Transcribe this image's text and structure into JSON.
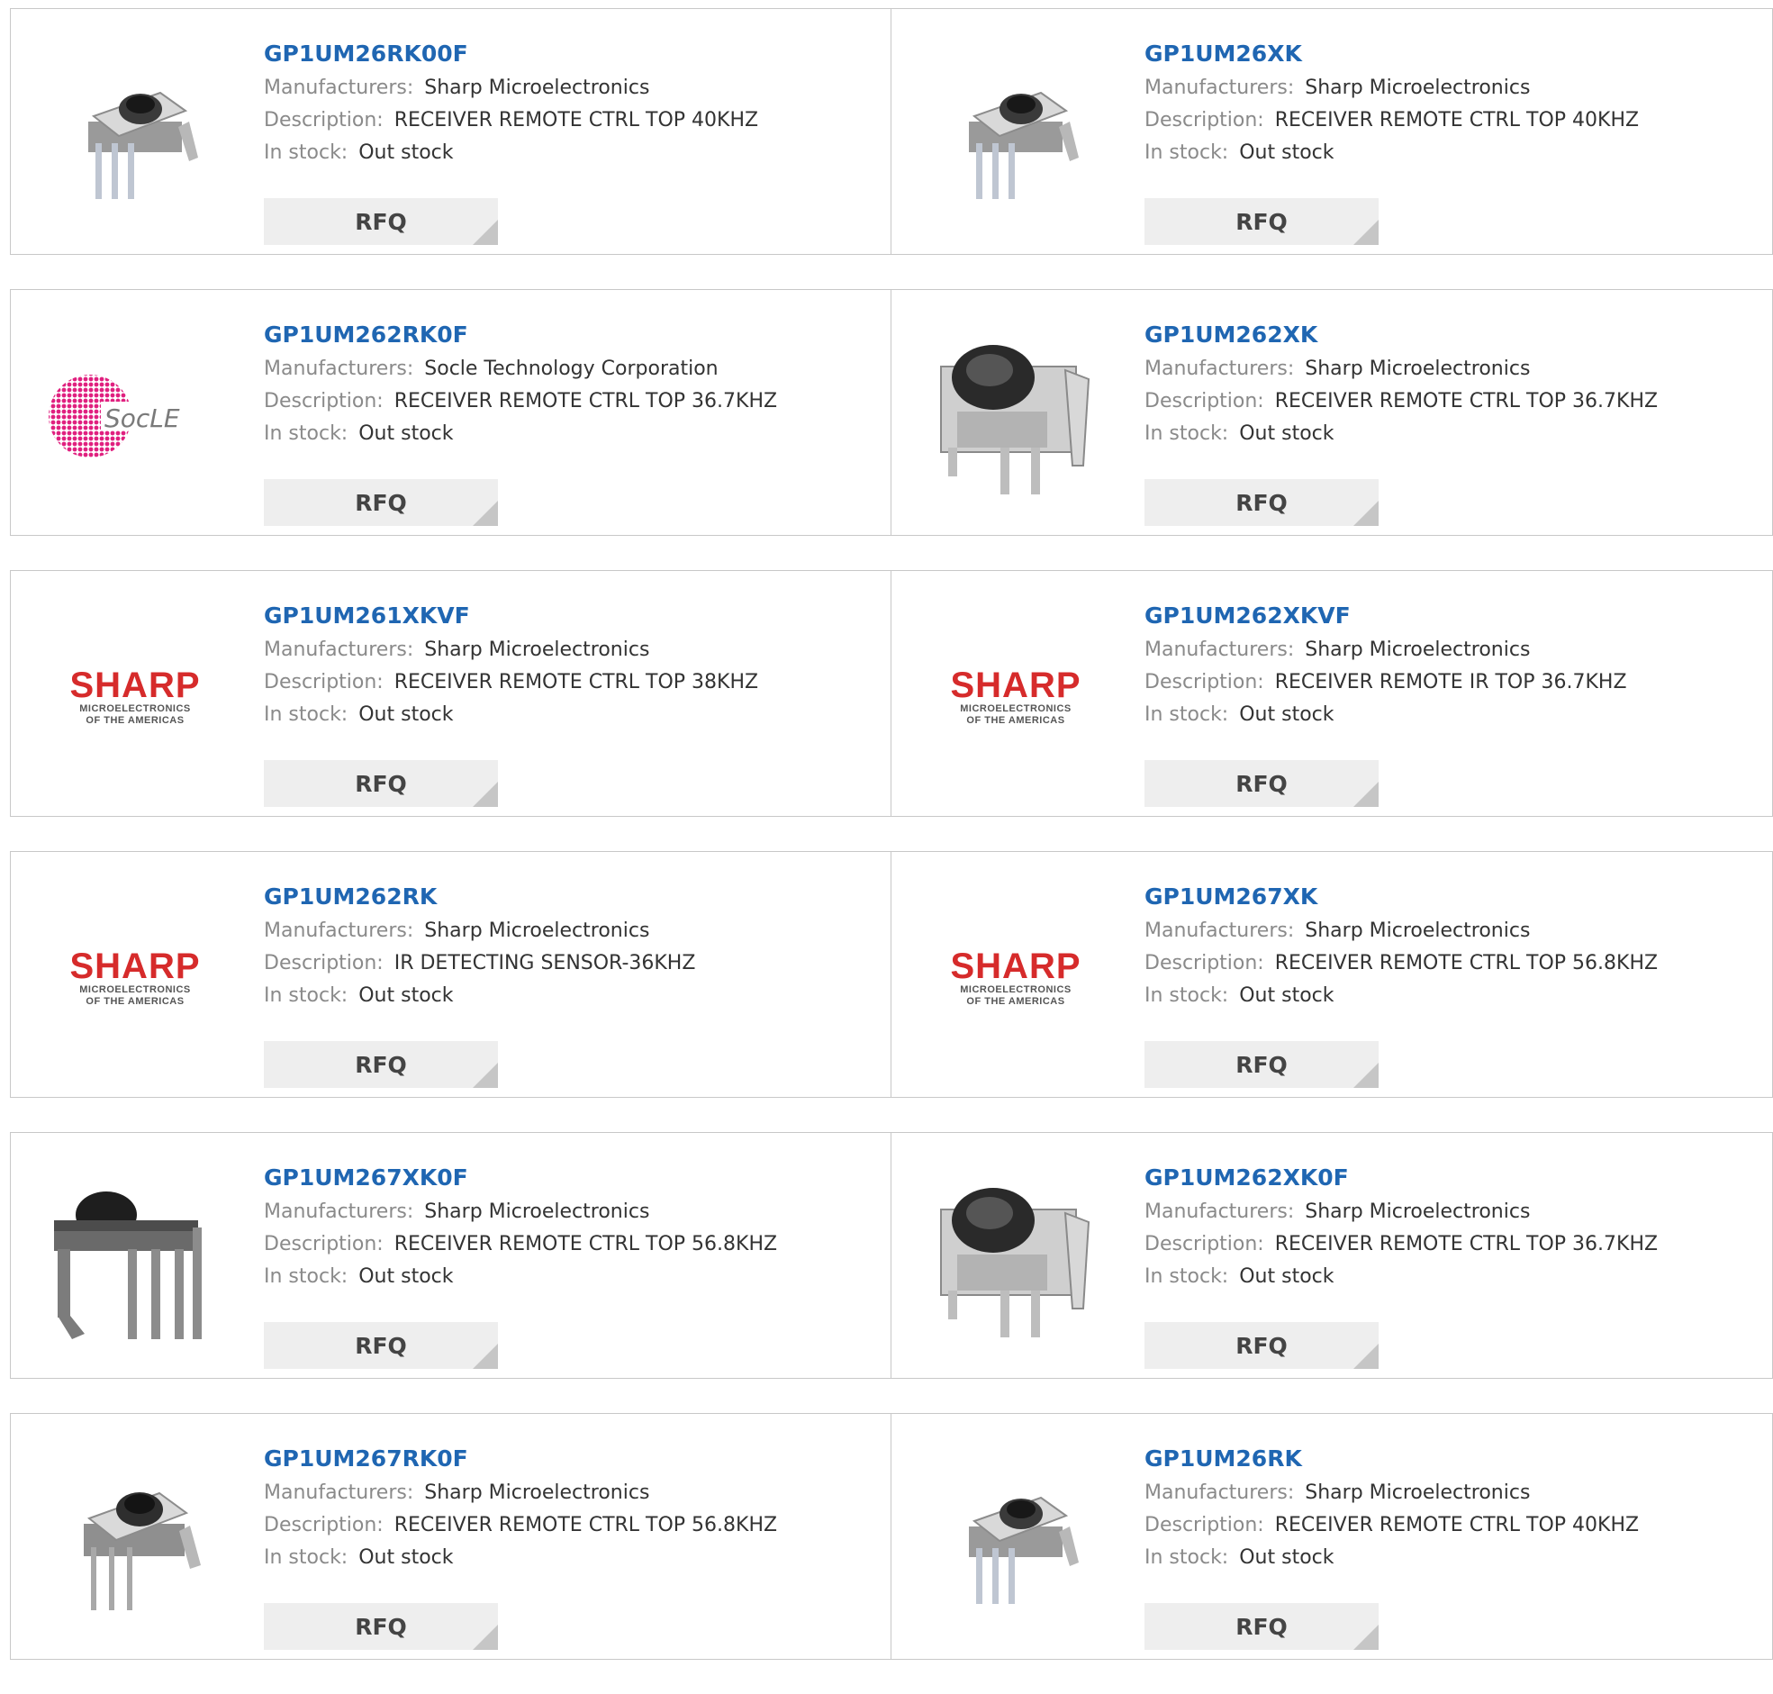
{
  "colors": {
    "part_link": "#1f66b2",
    "label": "#8a8a8a",
    "value": "#333333",
    "button_bg": "#eeeeee",
    "border": "#c8c8c8",
    "sharp_red": "#d62b2b",
    "socle_pink": "#e0207f"
  },
  "labels": {
    "manufacturers": "Manufacturers:",
    "description": "Description:",
    "stock": "In stock:",
    "rfq": "RFQ"
  },
  "logos": {
    "sharp_word": "SHARP",
    "sharp_sub1": "MICROELECTRONICS",
    "sharp_sub2": "OF THE AMERICAS",
    "socle_word": "SocLE"
  },
  "products": [
    {
      "part": "GP1UM26RK00F",
      "manufacturer": "Sharp Microelectronics",
      "description": "RECEIVER REMOTE CTRL TOP 40KHZ",
      "stock": "Out stock",
      "image": "ir-receiver-small-icon"
    },
    {
      "part": "GP1UM26XK",
      "manufacturer": "Sharp Microelectronics",
      "description": "RECEIVER REMOTE CTRL TOP 40KHZ",
      "stock": "Out stock",
      "image": "ir-receiver-small-icon"
    },
    {
      "part": "GP1UM262RK0F",
      "manufacturer": "Socle Technology Corporation",
      "description": "RECEIVER REMOTE CTRL TOP 36.7KHZ",
      "stock": "Out stock",
      "image": "socle-logo"
    },
    {
      "part": "GP1UM262XK",
      "manufacturer": "Sharp Microelectronics",
      "description": "RECEIVER REMOTE CTRL TOP 36.7KHZ",
      "stock": "Out stock",
      "image": "ir-receiver-large-icon"
    },
    {
      "part": "GP1UM261XKVF",
      "manufacturer": "Sharp Microelectronics",
      "description": "RECEIVER REMOTE CTRL TOP 38KHZ",
      "stock": "Out stock",
      "image": "sharp-logo"
    },
    {
      "part": "GP1UM262XKVF",
      "manufacturer": "Sharp Microelectronics",
      "description": "RECEIVER REMOTE IR TOP 36.7KHZ",
      "stock": "Out stock",
      "image": "sharp-logo"
    },
    {
      "part": "GP1UM262RK",
      "manufacturer": "Sharp Microelectronics",
      "description": "IR DETECTING SENSOR-36KHZ",
      "stock": "Out stock",
      "image": "sharp-logo"
    },
    {
      "part": "GP1UM267XK",
      "manufacturer": "Sharp Microelectronics",
      "description": "RECEIVER REMOTE CTRL TOP 56.8KHZ",
      "stock": "Out stock",
      "image": "sharp-logo"
    },
    {
      "part": "GP1UM267XK0F",
      "manufacturer": "Sharp Microelectronics",
      "description": "RECEIVER REMOTE CTRL TOP 56.8KHZ",
      "stock": "Out stock",
      "image": "ir-receiver-side-icon"
    },
    {
      "part": "GP1UM262XK0F",
      "manufacturer": "Sharp Microelectronics",
      "description": "RECEIVER REMOTE CTRL TOP 36.7KHZ",
      "stock": "Out stock",
      "image": "ir-receiver-large-icon"
    },
    {
      "part": "GP1UM267RK0F",
      "manufacturer": "Sharp Microelectronics",
      "description": "RECEIVER REMOTE CTRL TOP 56.8KHZ",
      "stock": "Out stock",
      "image": "ir-receiver-small-icon"
    },
    {
      "part": "GP1UM26RK",
      "manufacturer": "Sharp Microelectronics",
      "description": "RECEIVER REMOTE CTRL TOP 40KHZ",
      "stock": "Out stock",
      "image": "ir-receiver-small-icon"
    }
  ]
}
